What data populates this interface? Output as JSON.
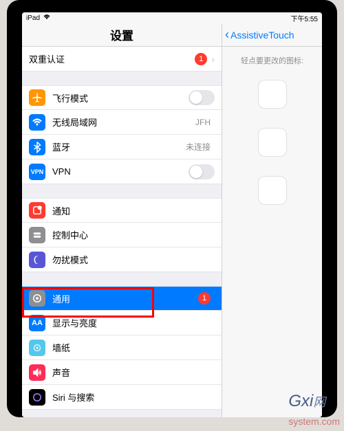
{
  "status": {
    "device": "iPad",
    "time": "下午5:55"
  },
  "left": {
    "title": "设置",
    "double_auth": "双重认证",
    "badge1": "1",
    "airplane": "飞行模式",
    "wifi": "无线局域网",
    "wifi_val": "JFH",
    "bt": "蓝牙",
    "bt_val": "未连接",
    "vpn": "VPN",
    "notif": "通知",
    "control": "控制中心",
    "dnd": "勿扰模式",
    "general": "通用",
    "general_badge": "1",
    "display": "显示与亮度",
    "wallpaper": "墙纸",
    "sound": "声音",
    "siri": "Siri 与搜索"
  },
  "right": {
    "back": "AssistiveTouch",
    "hint": "轻点要更改的图标:"
  },
  "watermark": {
    "main": "Gxi",
    "sub": "system.com"
  }
}
